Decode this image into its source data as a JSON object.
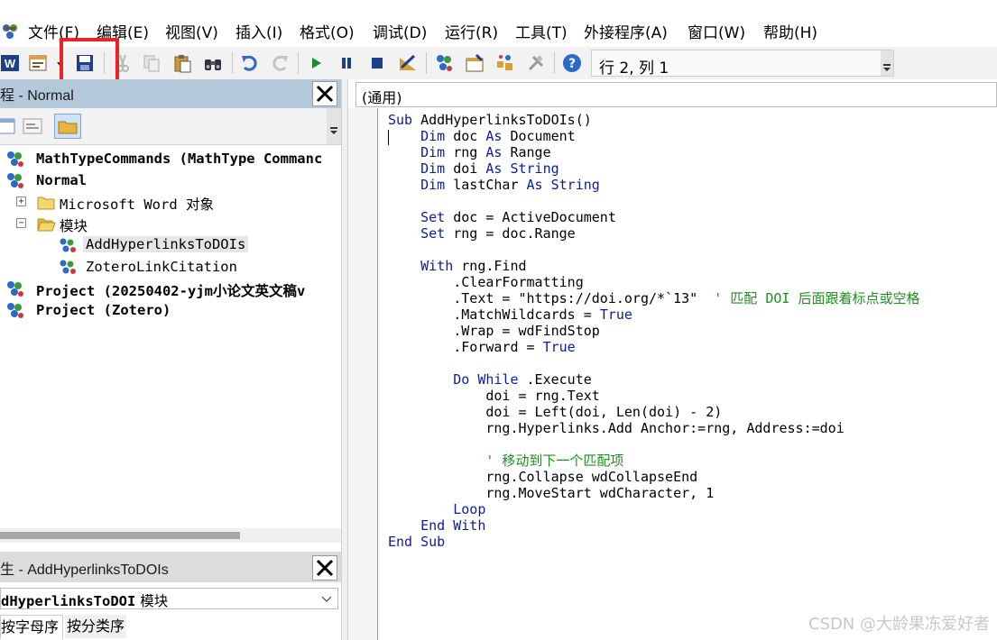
{
  "menu": {
    "items": [
      "文件(F)",
      "编辑(E)",
      "视图(V)",
      "插入(I)",
      "格式(O)",
      "调试(D)",
      "运行(R)",
      "工具(T)",
      "外接程序(A)",
      "窗口(W)",
      "帮助(H)"
    ]
  },
  "toolbar": {
    "position_label": "行 2, 列 1",
    "icons": [
      "word-icon",
      "insert-userform-icon",
      "save-icon",
      "cut-icon",
      "copy-icon",
      "paste-icon",
      "find-icon",
      "undo-icon",
      "redo-icon",
      "run-icon",
      "break-icon",
      "reset-icon",
      "design-mode-icon",
      "project-explorer-icon",
      "properties-window-icon",
      "object-browser-icon",
      "toolbox-icon",
      "help-icon"
    ],
    "highlight_color": "#e8242b"
  },
  "project": {
    "title": "程 - Normal",
    "tree": [
      {
        "label": "MathTypeCommands (MathType Commanc",
        "bold": true
      },
      {
        "label": "Normal",
        "bold": true
      },
      {
        "label": "Microsoft Word 对象",
        "bold": false
      },
      {
        "label": "模块",
        "bold": false
      },
      {
        "label": "AddHyperlinksToDOIs",
        "bold": false,
        "selected": true
      },
      {
        "label": "ZoteroLinkCitation",
        "bold": false
      },
      {
        "label": "Project (20250402-yjm小论文英文稿v",
        "bold": true
      },
      {
        "label": "Project (Zotero)",
        "bold": true
      }
    ]
  },
  "properties": {
    "title": "生 - AddHyperlinksToDOIs",
    "object_name": "dHyperlinksToDOI",
    "object_type": "模块",
    "tabs": [
      "按字母序",
      "按分类序"
    ]
  },
  "code": {
    "object_combo": "(通用)",
    "keyword_color": "#0b1c9e",
    "comment_color": "#1f8f1f",
    "lines": [
      [
        {
          "t": "Sub",
          "k": "kw"
        },
        {
          "t": " AddHyperlinksToDOIs()"
        }
      ],
      [
        {
          "t": "    "
        },
        {
          "t": "Dim",
          "k": "kw"
        },
        {
          "t": " doc "
        },
        {
          "t": "As",
          "k": "kw"
        },
        {
          "t": " Document"
        }
      ],
      [
        {
          "t": "    "
        },
        {
          "t": "Dim",
          "k": "kw"
        },
        {
          "t": " rng "
        },
        {
          "t": "As",
          "k": "kw"
        },
        {
          "t": " Range"
        }
      ],
      [
        {
          "t": "    "
        },
        {
          "t": "Dim",
          "k": "kw"
        },
        {
          "t": " doi "
        },
        {
          "t": "As",
          "k": "kw"
        },
        {
          "t": " "
        },
        {
          "t": "String",
          "k": "kw"
        }
      ],
      [
        {
          "t": "    "
        },
        {
          "t": "Dim",
          "k": "kw"
        },
        {
          "t": " lastChar "
        },
        {
          "t": "As",
          "k": "kw"
        },
        {
          "t": " "
        },
        {
          "t": "String",
          "k": "kw"
        }
      ],
      [],
      [
        {
          "t": "    "
        },
        {
          "t": "Set",
          "k": "kw"
        },
        {
          "t": " doc = ActiveDocument"
        }
      ],
      [
        {
          "t": "    "
        },
        {
          "t": "Set",
          "k": "kw"
        },
        {
          "t": " rng = doc.Range"
        }
      ],
      [],
      [
        {
          "t": "    "
        },
        {
          "t": "With",
          "k": "kw"
        },
        {
          "t": " rng.Find"
        }
      ],
      [
        {
          "t": "        .ClearFormatting"
        }
      ],
      [
        {
          "t": "        .Text = \"https://doi.org/*`13\"  "
        },
        {
          "t": "' 匹配 DOI 后面跟着标点或空格",
          "k": "cm"
        }
      ],
      [
        {
          "t": "        .MatchWildcards = "
        },
        {
          "t": "True",
          "k": "kw"
        }
      ],
      [
        {
          "t": "        .Wrap = wdFindStop"
        }
      ],
      [
        {
          "t": "        .Forward = "
        },
        {
          "t": "True",
          "k": "kw"
        }
      ],
      [],
      [
        {
          "t": "        "
        },
        {
          "t": "Do While",
          "k": "kw"
        },
        {
          "t": " .Execute"
        }
      ],
      [
        {
          "t": "            doi = rng.Text"
        }
      ],
      [
        {
          "t": "            doi = Left(doi, Len(doi) - 2)"
        }
      ],
      [
        {
          "t": "            rng.Hyperlinks.Add Anchor:=rng, Address:=doi"
        }
      ],
      [],
      [
        {
          "t": "            "
        },
        {
          "t": "' 移动到下一个匹配项",
          "k": "cm"
        }
      ],
      [
        {
          "t": "            rng.Collapse wdCollapseEnd"
        }
      ],
      [
        {
          "t": "            rng.MoveStart wdCharacter, 1"
        }
      ],
      [
        {
          "t": "        "
        },
        {
          "t": "Loop",
          "k": "kw"
        }
      ],
      [
        {
          "t": "    "
        },
        {
          "t": "End With",
          "k": "kw"
        }
      ],
      [
        {
          "t": "End Sub",
          "k": "kw"
        }
      ]
    ]
  },
  "watermark": "CSDN @大龄果冻爱好者"
}
